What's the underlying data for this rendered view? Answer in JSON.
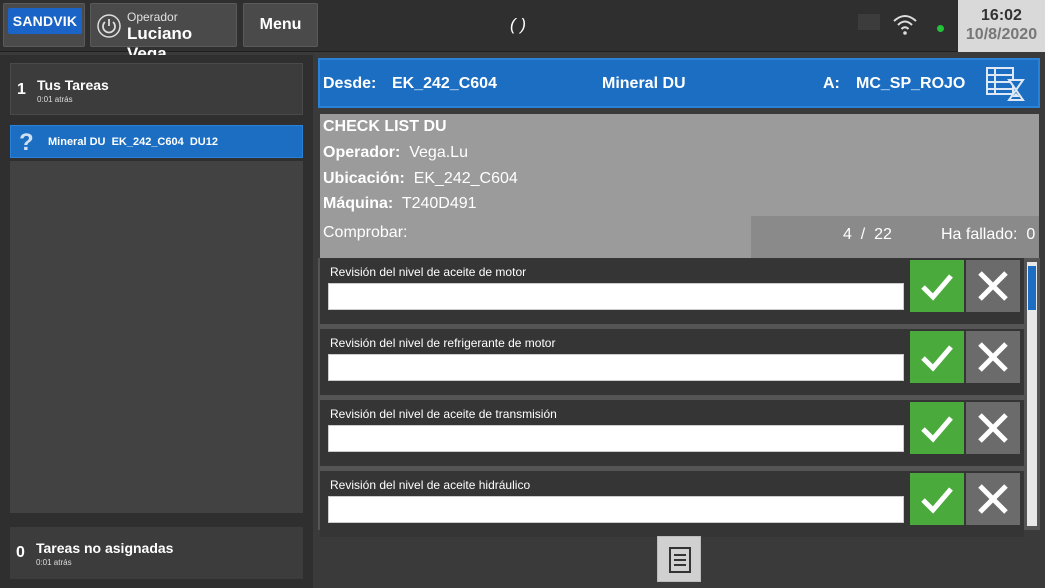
{
  "topbar": {
    "logo_text": "SANDVIK",
    "operator_label": "Operador",
    "operator_name": "Luciano Vega",
    "menu_label": "Menu",
    "center_text": "( )",
    "time": "16:02",
    "date": "10/8/2020",
    "icons": [
      "power-icon",
      "wifi-icon"
    ]
  },
  "left": {
    "my_tasks": {
      "count": "1",
      "title": "Tus Tareas",
      "sub": "0:01 atrás"
    },
    "task_item": {
      "icon": "?",
      "text": "Mineral DU  EK_242_C604  DU12"
    },
    "unassigned": {
      "count": "0",
      "title": "Tareas no asignadas",
      "sub": "0:01 atrás"
    }
  },
  "route": {
    "from_label": "Desde:",
    "from_value": "EK_242_C604",
    "material": "Mineral DU",
    "to_label": "A:",
    "to_value": "MC_SP_ROJO"
  },
  "checklist": {
    "title": "CHECK LIST DU",
    "operator_label": "Operador:",
    "operator_value": "Vega.Lu",
    "location_label": "Ubicación:",
    "location_value": "EK_242_C604",
    "machine_label": "Máquina:",
    "machine_value": "T240D491",
    "check_label": "Comprobar:",
    "progress": "4  /  22",
    "failed": "Ha fallado:  0",
    "items": [
      {
        "label": "Revisión del nivel de aceite de motor",
        "value": ""
      },
      {
        "label": "Revisión del nivel de refrigerante de motor",
        "value": ""
      },
      {
        "label": "Revisión del nivel de aceite de transmisión",
        "value": ""
      },
      {
        "label": "Revisión del nivel de aceite hidráulico",
        "value": ""
      }
    ]
  },
  "colors": {
    "accent": "#1b6ec2",
    "ok": "#4aaa3c",
    "fail": "#6b6b6b"
  }
}
